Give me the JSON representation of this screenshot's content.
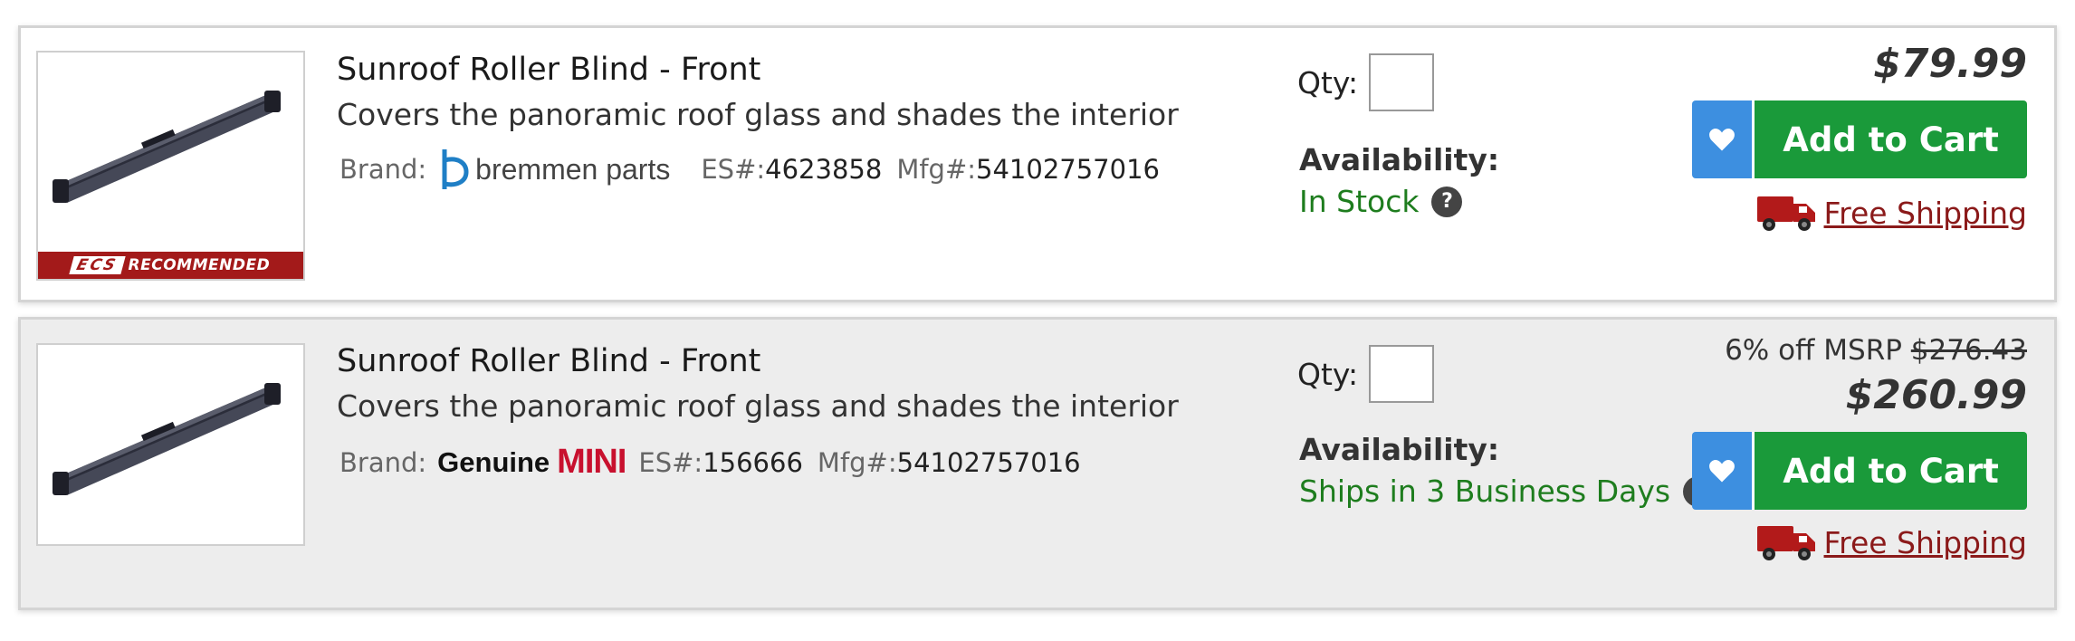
{
  "products": [
    {
      "title": "Sunroof Roller Blind - Front",
      "description": "Covers the panoramic roof glass and shades the interior",
      "brand_label": "Brand:",
      "brand_name": "bremmen parts",
      "es_label": "ES#:",
      "es_number": "4623858",
      "mfg_label": "Mfg#:",
      "mfg_number": "54102757016",
      "badge_logo": "ECS",
      "badge_text": "RECOMMENDED",
      "qty_label": "Qty:",
      "availability_label": "Availability:",
      "availability_status": "In Stock",
      "help_glyph": "?",
      "price": "$79.99",
      "add_to_cart": "Add to Cart",
      "shipping": "Free Shipping"
    },
    {
      "title": "Sunroof Roller Blind - Front",
      "description": "Covers the panoramic roof glass and shades the interior",
      "brand_label": "Brand:",
      "brand_name_part1": "Genuine",
      "brand_name_part2": "MINI",
      "es_label": "ES#:",
      "es_number": "156666",
      "mfg_label": "Mfg#:",
      "mfg_number": "54102757016",
      "qty_label": "Qty:",
      "availability_label": "Availability:",
      "availability_status": "Ships in 3 Business Days",
      "help_glyph": "?",
      "msrp_text": "6% off MSRP",
      "msrp_price": "$276.43",
      "price": "$260.99",
      "add_to_cart": "Add to Cart",
      "shipping": "Free Shipping"
    }
  ],
  "colors": {
    "add_to_cart": "#1a9a3a",
    "wishlist": "#3d8fe0",
    "in_stock": "#1e7d1e",
    "shipping_link": "#8b1a1a",
    "badge": "#a31a1a",
    "mini_brand": "#c8102e",
    "bremmen_brand": "#1f7fc6"
  },
  "icons": [
    "heart-icon",
    "truck-icon",
    "help-icon",
    "product-image"
  ]
}
